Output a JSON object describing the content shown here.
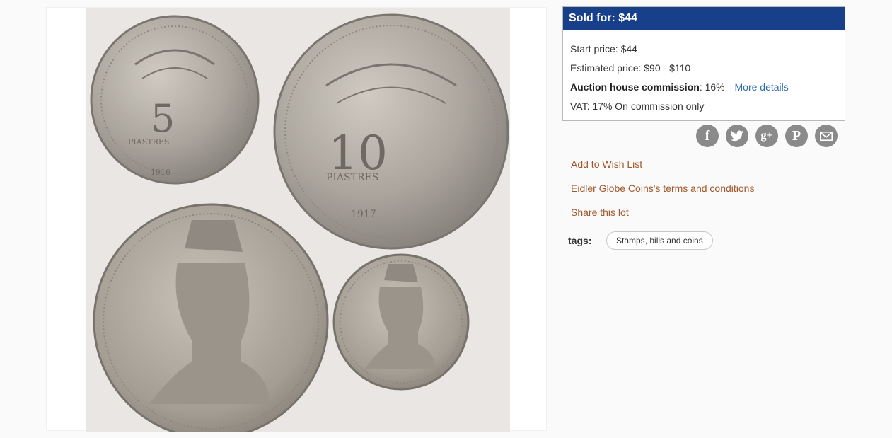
{
  "photo": {
    "coins": [
      {
        "value_text": "5",
        "unit_text": "PIASTRES",
        "date_text": "1916"
      },
      {
        "value_text": "10",
        "unit_text": "PIASTRES",
        "date_text": "1917"
      }
    ]
  },
  "price_box": {
    "header": "Sold for: $44",
    "start_price_label": "Start price:",
    "start_price_value": "$44",
    "estimated_label": "Estimated price:",
    "estimated_value": "$90 - $110",
    "commission_label": "Auction house commission",
    "commission_value": ": 16%",
    "more_details": "More details",
    "vat_text": "VAT: 17% On commission only"
  },
  "share": {
    "icons": [
      "facebook-icon",
      "twitter-icon",
      "google-plus-icon",
      "pinterest-icon",
      "email-icon"
    ],
    "glyphs": {
      "facebook": "f",
      "google_plus": "g+",
      "pinterest": "P"
    }
  },
  "actions": {
    "wishlist": "Add to Wish List",
    "terms": "Eidler Globe Coins's terms and conditions",
    "share": "Share this lot"
  },
  "tags": {
    "label": "tags:",
    "items": [
      "Stamps, bills and coins"
    ]
  },
  "colors": {
    "header_bg": "#173f8a",
    "link_blue": "#2f6fb0",
    "link_brown": "#a1572a",
    "icon_gray": "#8a8a8a"
  }
}
